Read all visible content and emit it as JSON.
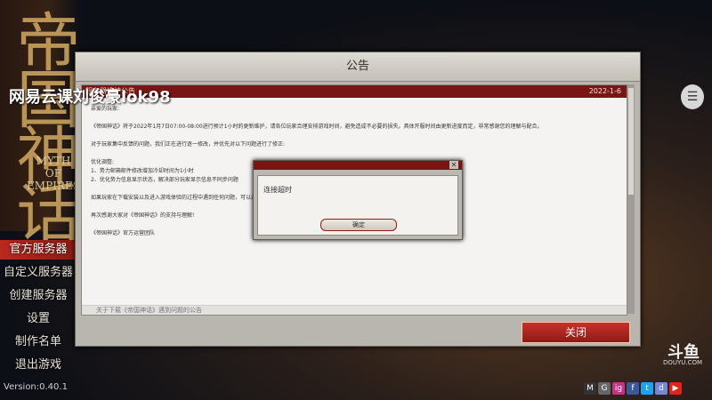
{
  "branding": {
    "logo_cn": "帝国神话",
    "logo_en": "MYTH OF EMPIRES"
  },
  "watermark": "网易云课刘俊豪lok98",
  "side_menu": [
    {
      "label": "官方服务器",
      "active": true
    },
    {
      "label": "自定义服务器",
      "active": false
    },
    {
      "label": "创建服务器",
      "active": false
    },
    {
      "label": "设置",
      "active": false
    },
    {
      "label": "制作名单",
      "active": false
    },
    {
      "label": "退出游戏",
      "active": false
    }
  ],
  "version": "Version:0.40.1",
  "announcement": {
    "title": "公告",
    "notice_title": "服务器维护公告",
    "notice_date": "2022-1-6",
    "greeting": "亲爱的玩家:",
    "para1": "《帝国神话》将于2022年1月7日07:00-08:00进行预计1小时的更新维护，请各位玩家合理安排游戏时间，避免造成不必要的损失。具体开服时间由更新进度而定，非常感谢您的理解与配合。",
    "para2": "对于玩家集中反馈的问题，我们正在进行逐一修改，并优先对以下问题进行了修正:",
    "opt_title": "优化调整:",
    "opt1": "1、势力邮箱邮件修改增加冷却时间为1小时",
    "opt2": "2、优化势力信息显示状态，解决部分玩家显示信息不同步问题",
    "para3": "如果玩家在下载安装以及进入游戏体验的过程中遇到任何问题，可以通过以下渠道进行反馈：",
    "thanks": "再次感谢大家对《帝国神话》的支持与理解!",
    "sign": "《帝国神话》官方运营团队",
    "footer_item": "关于下载《帝国神话》遇到问题的公告",
    "close_label": "关闭"
  },
  "timeout_dialog": {
    "message": "连接超时",
    "ok_label": "确定"
  },
  "douyu": {
    "logo": "斗鱼",
    "sub": "DOUYU.COM"
  },
  "socials": [
    "M",
    "G",
    "ig",
    "f",
    "t",
    "d",
    "▶"
  ]
}
